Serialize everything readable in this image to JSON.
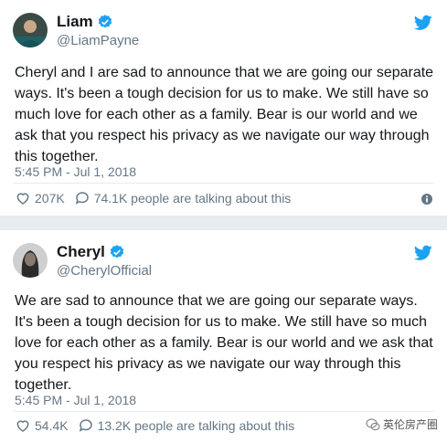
{
  "tweets": [
    {
      "name": "Liam",
      "handle": "@LiamPayne",
      "text": "Cheryl and I are sad to announce that we are going our separate ways. It's been a tough decision for us to make. We still have so much love for each other as a family. Bear is our world and we ask that you respect his privacy as we navigate our way through this together.",
      "timestamp": "5:45 PM - Jul 1, 2018",
      "likes": "207K",
      "talking": "74.1K people are talking about this"
    },
    {
      "name": "Cheryl",
      "handle": "@CherylOfficial",
      "text": "We are sad to announce that we are going our separate ways. It's been a tough decision for us to make. We still have so much love for each other as a family.  Bear is our world and we ask that you respect his privacy as we navigate our way through this together.",
      "timestamp": "5:45 PM - Jul 1, 2018",
      "likes": "54.4K",
      "talking": "13.2K people are talking about this"
    }
  ],
  "watermark": {
    "text": "英伦房产圈"
  },
  "icons": {
    "verified": "verified-badge-icon",
    "bird": "twitter-bird-icon",
    "like": "heart-icon",
    "reply": "speech-bubble-icon",
    "info": "info-icon"
  },
  "colors": {
    "twitter_blue": "#1da1f2",
    "muted": "#657786",
    "background": "#e6ecf0"
  }
}
